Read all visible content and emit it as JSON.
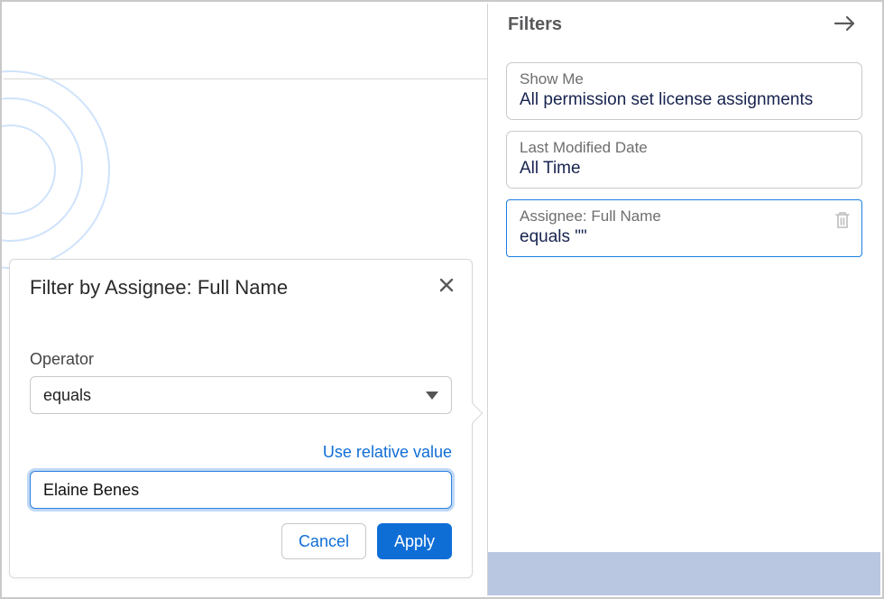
{
  "panel": {
    "title": "Filters",
    "cards": [
      {
        "label": "Show Me",
        "value": "All permission set license assignments"
      },
      {
        "label": "Last Modified Date",
        "value": "All Time"
      },
      {
        "label": "Assignee: Full Name",
        "value": "equals \"\""
      }
    ]
  },
  "popover": {
    "title": "Filter by Assignee: Full Name",
    "operator_label": "Operator",
    "operator_value": "equals",
    "relative_link": "Use relative value",
    "value": "Elaine Benes",
    "cancel_label": "Cancel",
    "apply_label": "Apply"
  }
}
